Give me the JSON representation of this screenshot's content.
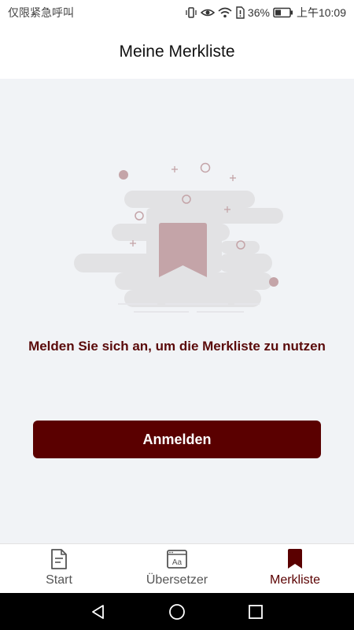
{
  "status_bar": {
    "carrier_text": "仅限紧急呼叫",
    "battery": "36%",
    "time": "上午10:09"
  },
  "header": {
    "title": "Meine Merkliste"
  },
  "main": {
    "message": "Melden Sie sich an, um die Merkliste zu nutzen",
    "login_button_label": "Anmelden",
    "illustration_icon": "bookmark-icon"
  },
  "tabs": [
    {
      "label": "Start",
      "icon": "document-icon",
      "active": false
    },
    {
      "label": "Übersetzer",
      "icon": "translator-icon",
      "active": false
    },
    {
      "label": "Merkliste",
      "icon": "bookmark-icon",
      "active": true
    }
  ],
  "colors": {
    "accent": "#5a0000",
    "background": "#f1f3f6",
    "illustration_bookmark": "#c4a4a8",
    "illustration_shapes": "#e2e2e4"
  },
  "nav_bar": {
    "buttons": [
      "back-icon",
      "home-icon",
      "recents-icon"
    ]
  }
}
